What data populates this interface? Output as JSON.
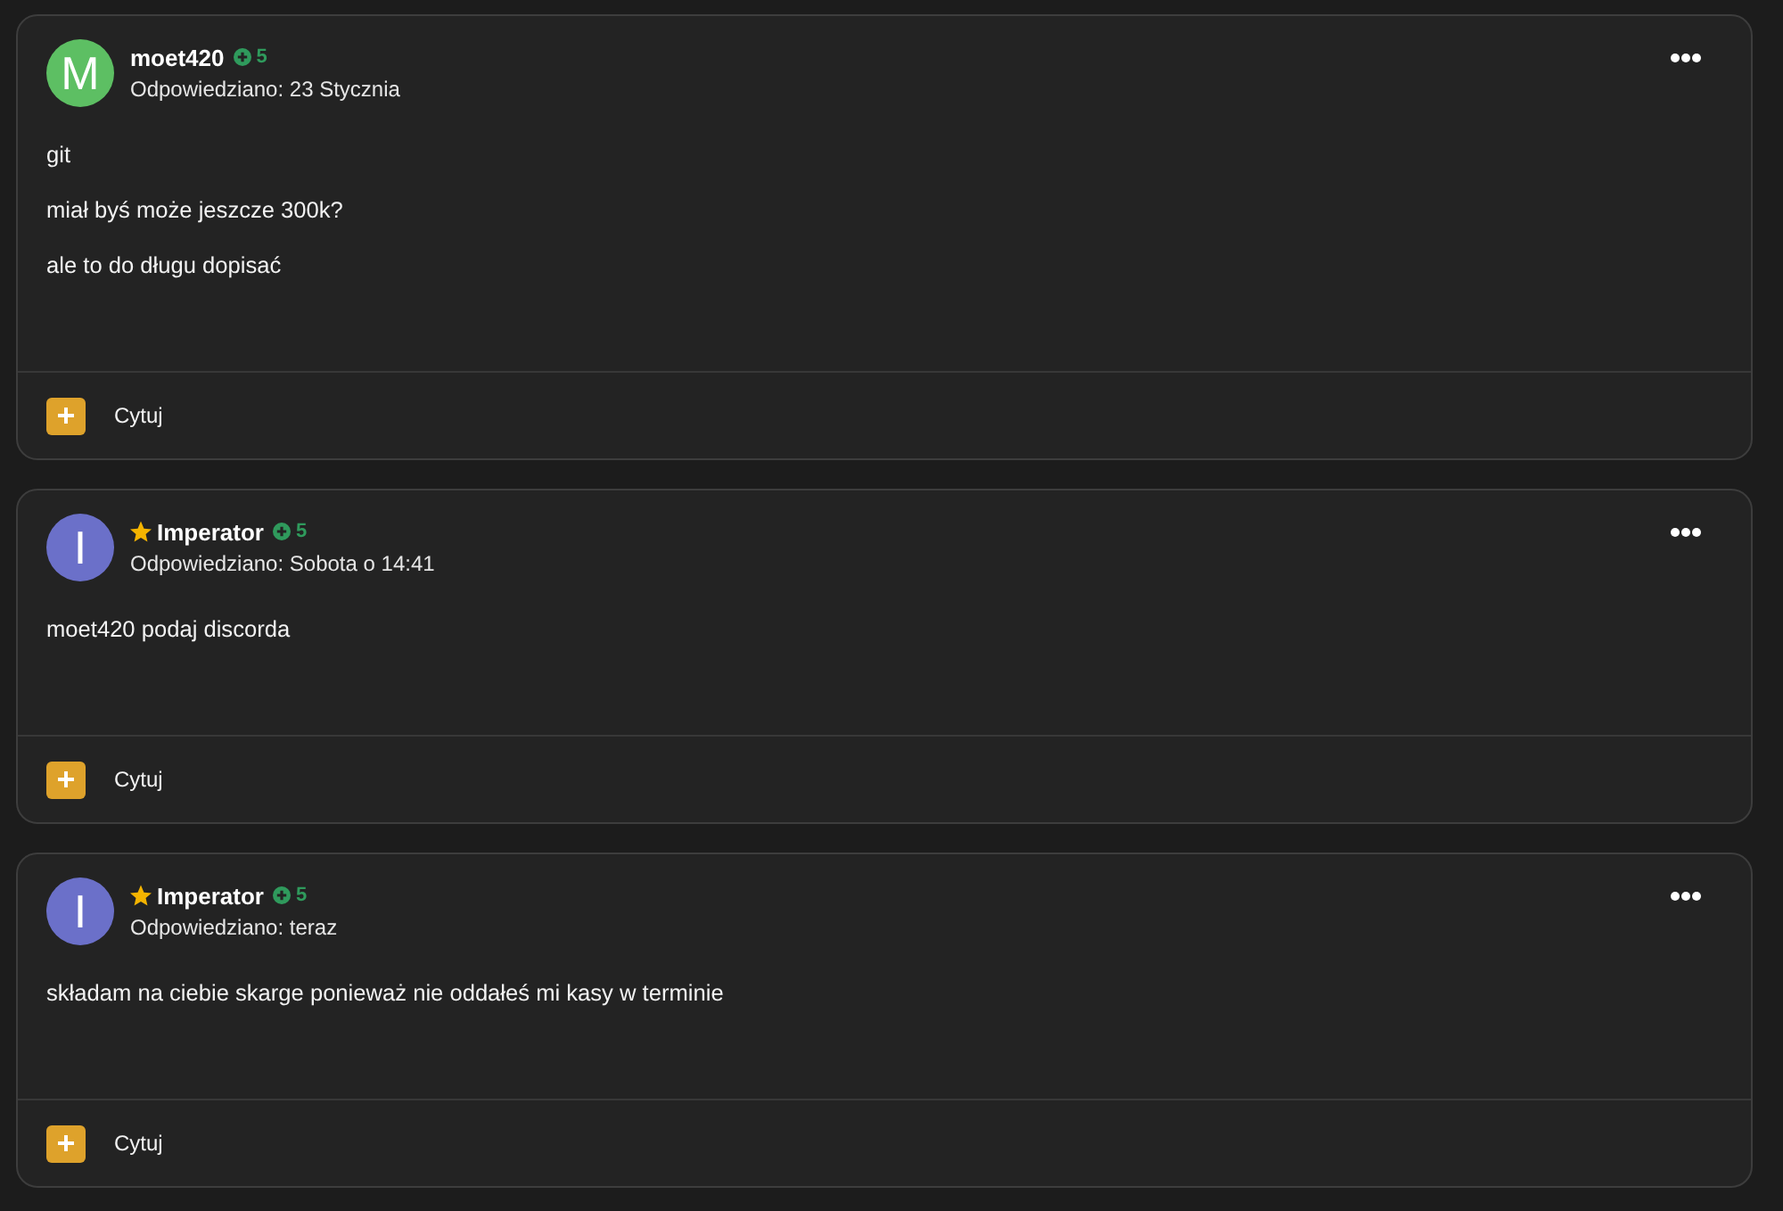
{
  "posts": [
    {
      "author": {
        "name": "moet420",
        "avatar_letter": "M",
        "color": "#5dbf63",
        "starred": false,
        "reputation": "5"
      },
      "date_label": "Odpowiedziano: 23 Stycznia",
      "paragraphs": [
        "git",
        "miał byś może jeszcze 300k?",
        "ale to do długu dopisać"
      ],
      "quote_label": "Cytuj"
    },
    {
      "author": {
        "name": "Imperator",
        "avatar_letter": "I",
        "color": "#6b70c9",
        "starred": true,
        "reputation": "5"
      },
      "date_label": "Odpowiedziano: Sobota o 14:41",
      "paragraphs": [
        "moet420 podaj discorda"
      ],
      "quote_label": "Cytuj"
    },
    {
      "author": {
        "name": "Imperator",
        "avatar_letter": "I",
        "color": "#6b70c9",
        "starred": true,
        "reputation": "5"
      },
      "date_label": "Odpowiedziano: teraz",
      "paragraphs": [
        "składam na ciebie skarge ponieważ nie oddałeś mi kasy w terminie"
      ],
      "quote_label": "Cytuj"
    }
  ]
}
